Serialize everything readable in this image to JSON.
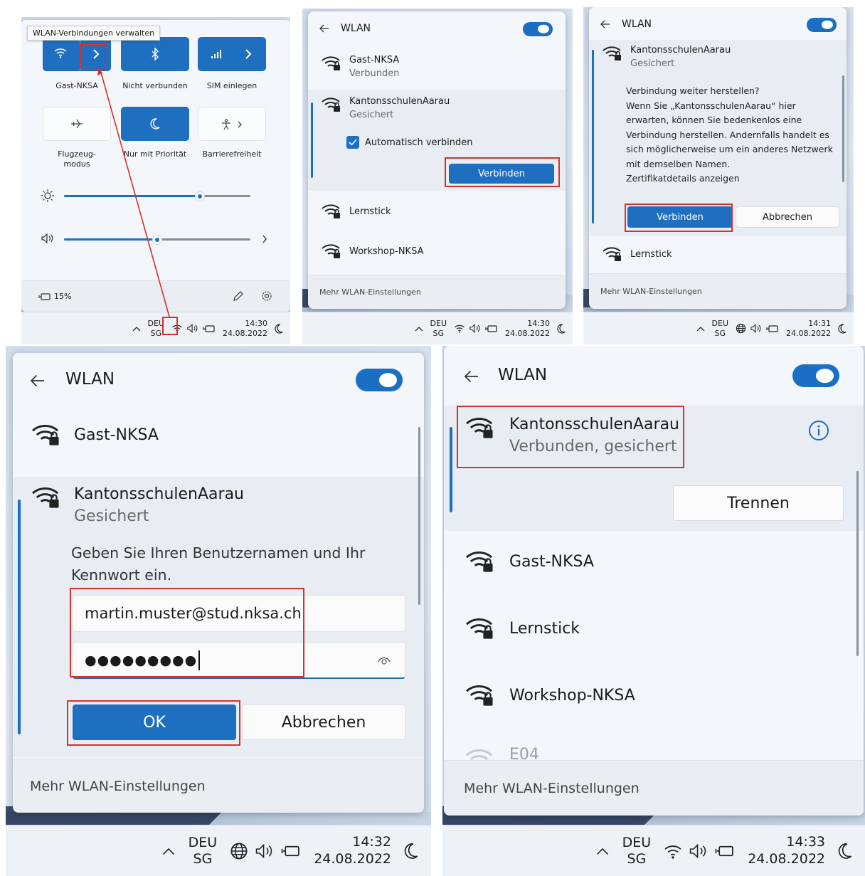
{
  "taskbar": {
    "lang_top": "DEU",
    "lang_bottom": "SG",
    "date": "24.08.2022",
    "times": [
      "14:30",
      "14:30",
      "14:31",
      "14:32",
      "14:33"
    ]
  },
  "quick_settings": {
    "tooltip": "WLAN-Verbindungen verwalten",
    "tiles": [
      {
        "label": "Gast-NKSA",
        "state": "on",
        "icon": "wifi-icon"
      },
      {
        "label": "Nicht verbunden",
        "state": "on",
        "icon": "bluetooth-icon"
      },
      {
        "label": "SIM einlegen",
        "state": "on",
        "icon": "cellular-icon"
      },
      {
        "label": "Flugzeug-modus",
        "label_line1": "Flugzeug-",
        "label_line2": "modus",
        "state": "off",
        "icon": "airplane-icon"
      },
      {
        "label": "Nur mit Priorität",
        "state": "on",
        "icon": "moon-icon"
      },
      {
        "label": "Barrierefreiheit",
        "state": "off",
        "icon": "accessibility-icon"
      }
    ],
    "brightness": 0.73,
    "volume": 0.5,
    "battery": "15%"
  },
  "wlan_title": "WLAN",
  "more_settings": "Mehr WLAN-Einstellungen",
  "networks": {
    "gast": "Gast-NKSA",
    "kanton": "KantonsschulenAarau",
    "lernstick": "Lernstick",
    "workshop": "Workshop-NKSA",
    "partial": "E04"
  },
  "status": {
    "connected": "Verbunden",
    "secured": "Gesichert",
    "connected_secured": "Verbunden, gesichert"
  },
  "panel2": {
    "auto_connect": "Automatisch verbinden",
    "connect": "Verbinden"
  },
  "panel3": {
    "warning_lines": [
      "Verbindung weiter herstellen?",
      "Wenn Sie „KantonsschulenAarau“ hier",
      "erwarten, können Sie bedenkenlos eine",
      "Verbindung herstellen. Andernfalls handelt es",
      "sich möglicherweise um ein anderes Netzwerk",
      "mit demselben Namen.",
      "Zertifikatdetails anzeigen"
    ],
    "connect": "Verbinden",
    "cancel": "Abbrechen"
  },
  "panel4": {
    "prompt_line1": "Geben Sie Ihren Benutzernamen und Ihr",
    "prompt_line2": "Kennwort ein.",
    "username": "martin.muster@stud.nksa.ch",
    "password": "●●●●●●●●●",
    "ok": "OK",
    "cancel": "Abbrechen"
  },
  "panel5": {
    "disconnect": "Trennen"
  },
  "colors": {
    "accent": "#1f6fc0",
    "highlight": "#d9302b"
  }
}
